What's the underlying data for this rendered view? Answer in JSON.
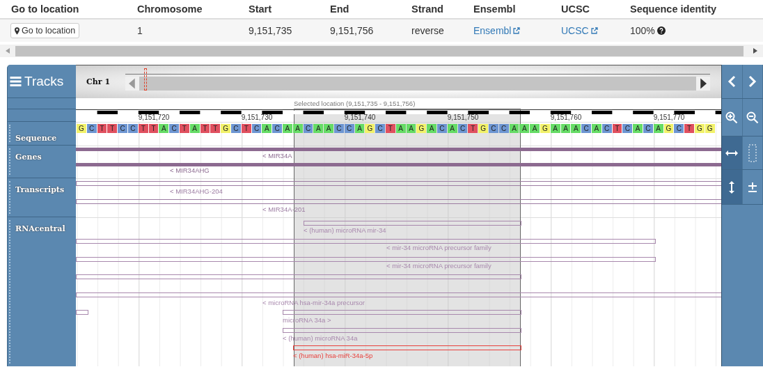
{
  "table": {
    "columns": [
      "Go to location",
      "Chromosome",
      "Start",
      "End",
      "Strand",
      "Ensembl",
      "UCSC",
      "Sequence identity"
    ],
    "row": {
      "go_button": "Go to location",
      "chromosome": "1",
      "start": "9,151,735",
      "end": "9,151,756",
      "strand": "reverse",
      "ensembl": "Ensembl",
      "ucsc": "UCSC",
      "identity": "100%"
    }
  },
  "browser": {
    "title": "Tracks",
    "chromosome_label": "Chr 1",
    "selection_label": "Selected location (9,151,735 - 9,151,756)",
    "ruler_ticks": [
      "9,151,720",
      "9,151,730",
      "9,151,740",
      "9,151,750",
      "9,151,760",
      "9,151,770"
    ],
    "sequence": [
      {
        "base": "G",
        "color": "#f2f26a"
      },
      {
        "base": "C",
        "color": "#6e96d2"
      },
      {
        "base": "T",
        "color": "#e0505f"
      },
      {
        "base": "T",
        "color": "#e0505f"
      },
      {
        "base": "C",
        "color": "#6e96d2"
      },
      {
        "base": "C",
        "color": "#6e96d2"
      },
      {
        "base": "T",
        "color": "#e0505f"
      },
      {
        "base": "T",
        "color": "#e0505f"
      },
      {
        "base": "A",
        "color": "#66dc66"
      },
      {
        "base": "C",
        "color": "#6e96d2"
      },
      {
        "base": "T",
        "color": "#e0505f"
      },
      {
        "base": "A",
        "color": "#66dc66"
      },
      {
        "base": "T",
        "color": "#e0505f"
      },
      {
        "base": "T",
        "color": "#e0505f"
      },
      {
        "base": "G",
        "color": "#f2f26a"
      },
      {
        "base": "C",
        "color": "#6e96d2"
      },
      {
        "base": "T",
        "color": "#e0505f"
      },
      {
        "base": "C",
        "color": "#6e96d2"
      },
      {
        "base": "A",
        "color": "#66dc66"
      },
      {
        "base": "C",
        "color": "#6e96d2"
      },
      {
        "base": "A",
        "color": "#66dc66"
      },
      {
        "base": "A",
        "color": "#66dc66"
      },
      {
        "base": "C",
        "color": "#6e96d2"
      },
      {
        "base": "A",
        "color": "#66dc66"
      },
      {
        "base": "A",
        "color": "#66dc66"
      },
      {
        "base": "C",
        "color": "#6e96d2"
      },
      {
        "base": "C",
        "color": "#6e96d2"
      },
      {
        "base": "A",
        "color": "#66dc66"
      },
      {
        "base": "G",
        "color": "#f2f26a"
      },
      {
        "base": "C",
        "color": "#6e96d2"
      },
      {
        "base": "T",
        "color": "#e0505f"
      },
      {
        "base": "A",
        "color": "#66dc66"
      },
      {
        "base": "A",
        "color": "#66dc66"
      },
      {
        "base": "G",
        "color": "#f2f26a"
      },
      {
        "base": "A",
        "color": "#66dc66"
      },
      {
        "base": "C",
        "color": "#6e96d2"
      },
      {
        "base": "A",
        "color": "#66dc66"
      },
      {
        "base": "C",
        "color": "#6e96d2"
      },
      {
        "base": "T",
        "color": "#e0505f"
      },
      {
        "base": "G",
        "color": "#f2f26a"
      },
      {
        "base": "C",
        "color": "#6e96d2"
      },
      {
        "base": "C",
        "color": "#6e96d2"
      },
      {
        "base": "A",
        "color": "#66dc66"
      },
      {
        "base": "A",
        "color": "#66dc66"
      },
      {
        "base": "A",
        "color": "#66dc66"
      },
      {
        "base": "G",
        "color": "#f2f26a"
      },
      {
        "base": "A",
        "color": "#66dc66"
      },
      {
        "base": "A",
        "color": "#66dc66"
      },
      {
        "base": "A",
        "color": "#66dc66"
      },
      {
        "base": "C",
        "color": "#6e96d2"
      },
      {
        "base": "A",
        "color": "#66dc66"
      },
      {
        "base": "C",
        "color": "#6e96d2"
      },
      {
        "base": "T",
        "color": "#e0505f"
      },
      {
        "base": "C",
        "color": "#6e96d2"
      },
      {
        "base": "A",
        "color": "#66dc66"
      },
      {
        "base": "C",
        "color": "#6e96d2"
      },
      {
        "base": "A",
        "color": "#66dc66"
      },
      {
        "base": "G",
        "color": "#f2f26a"
      },
      {
        "base": "C",
        "color": "#6e96d2"
      },
      {
        "base": "T",
        "color": "#e0505f"
      },
      {
        "base": "G",
        "color": "#f2f26a"
      },
      {
        "base": "G",
        "color": "#f2f26a"
      }
    ],
    "tracks": [
      {
        "name": "Sequence"
      },
      {
        "name": "Genes",
        "features": [
          {
            "kind": "bar",
            "color": "#8c6a90",
            "label": "< MIR34A"
          },
          {
            "kind": "bar",
            "color": "#8c6a90",
            "label": "< MIR34AHG"
          }
        ]
      },
      {
        "name": "Transcripts",
        "features": [
          {
            "kind": "box",
            "color": "#9c7ca2",
            "label": "< MIR34AHG-204"
          },
          {
            "kind": "box",
            "color": "#9c7ca2",
            "label": "< MIR34A-201"
          }
        ]
      },
      {
        "name": "RNAcentral",
        "features": [
          {
            "kind": "box",
            "color": "#a888ad",
            "label": "< (human) microRNA mir-34"
          },
          {
            "kind": "box",
            "color": "#a888ad",
            "label": "< mir-34 microRNA precursor family"
          },
          {
            "kind": "box",
            "color": "#a888ad",
            "label": "< mir-34 microRNA precursor family"
          },
          {
            "kind": "box",
            "color": "#a888ad"
          },
          {
            "kind": "box",
            "color": "#a888ad",
            "label": "< microRNA hsa-mir-34a precursor"
          },
          {
            "kind": "box",
            "color": "#a888ad"
          },
          {
            "kind": "box",
            "color": "#a888ad",
            "label": "microRNA 34a >"
          },
          {
            "kind": "box",
            "color": "#a888ad",
            "label": "< (human) microRNA 34a"
          },
          {
            "kind": "box",
            "color": "#e8413c",
            "label": "< (human) hsa-miR-34a-5p"
          }
        ]
      }
    ],
    "tools": [
      {
        "kind": "prev",
        "selected": false
      },
      {
        "kind": "next",
        "selected": false
      },
      {
        "kind": "zoom_in",
        "selected": false
      },
      {
        "kind": "zoom_out",
        "selected": false
      },
      {
        "kind": "drag_horizontal",
        "selected": true
      },
      {
        "kind": "select_region",
        "selected": false
      },
      {
        "kind": "resize_vertical",
        "selected": true
      },
      {
        "kind": "expand",
        "selected": false
      }
    ]
  }
}
